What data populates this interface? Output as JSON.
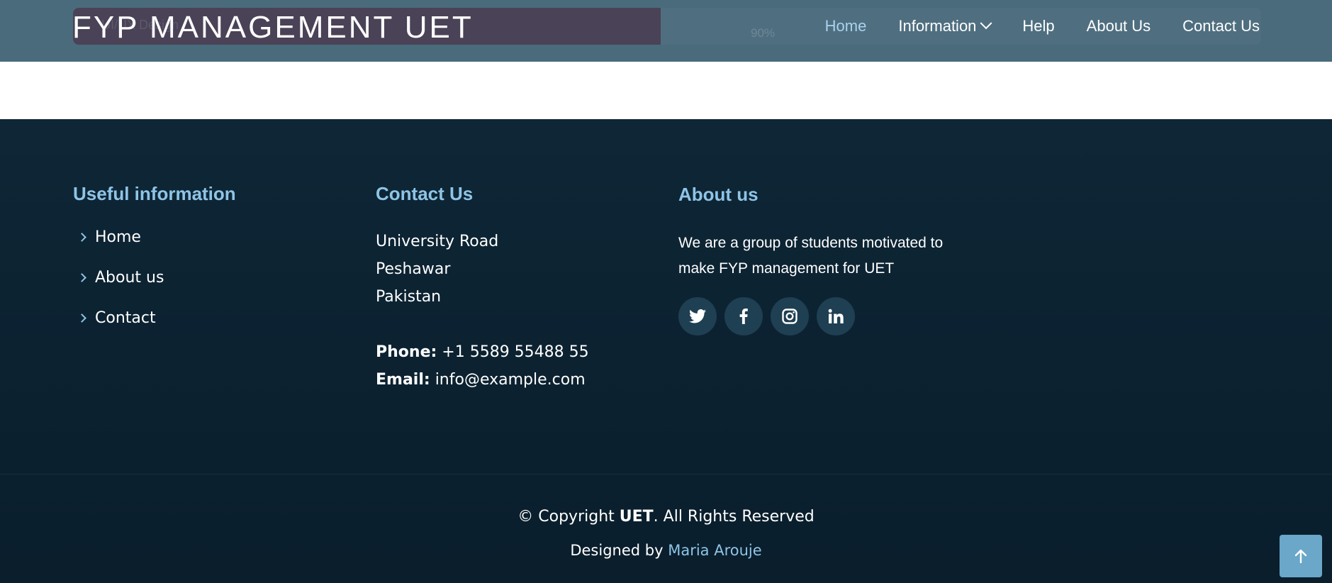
{
  "header": {
    "logo": "FYP MANAGEMENT UET",
    "progress": {
      "fraction": 0.9,
      "label": "90%",
      "under_text": "UI/UX Design"
    },
    "nav": [
      {
        "label": "Home",
        "active": true
      },
      {
        "label": "Information",
        "dropdown": true
      },
      {
        "label": "Help"
      },
      {
        "label": "About Us"
      },
      {
        "label": "Contact Us"
      }
    ]
  },
  "footer": {
    "useful": {
      "title": "Useful information",
      "links": [
        "Home",
        "About us",
        "Contact"
      ]
    },
    "contact": {
      "title": "Contact Us",
      "address": [
        "University Road",
        "Peshawar",
        "Pakistan"
      ],
      "phone_label": "Phone:",
      "phone": "+1 5589 55488 55",
      "email_label": "Email:",
      "email": "info@example.com"
    },
    "about": {
      "title": "About us",
      "text": "We are a group of students motivated to make FYP management for UET",
      "social": [
        "twitter-icon",
        "facebook-icon",
        "instagram-icon",
        "linkedin-icon"
      ]
    },
    "copyright_prefix": "© Copyright ",
    "copyright_brand": "UET",
    "copyright_suffix": ". All Rights Reserved",
    "designed_prefix": "Designed by ",
    "designer": "Maria Arouje"
  },
  "colors": {
    "accent": "#8ec4e6",
    "footer_bg": "#0e2636",
    "header_bg": "#4a6b7c",
    "back_to_top": "#6aa7c9"
  }
}
